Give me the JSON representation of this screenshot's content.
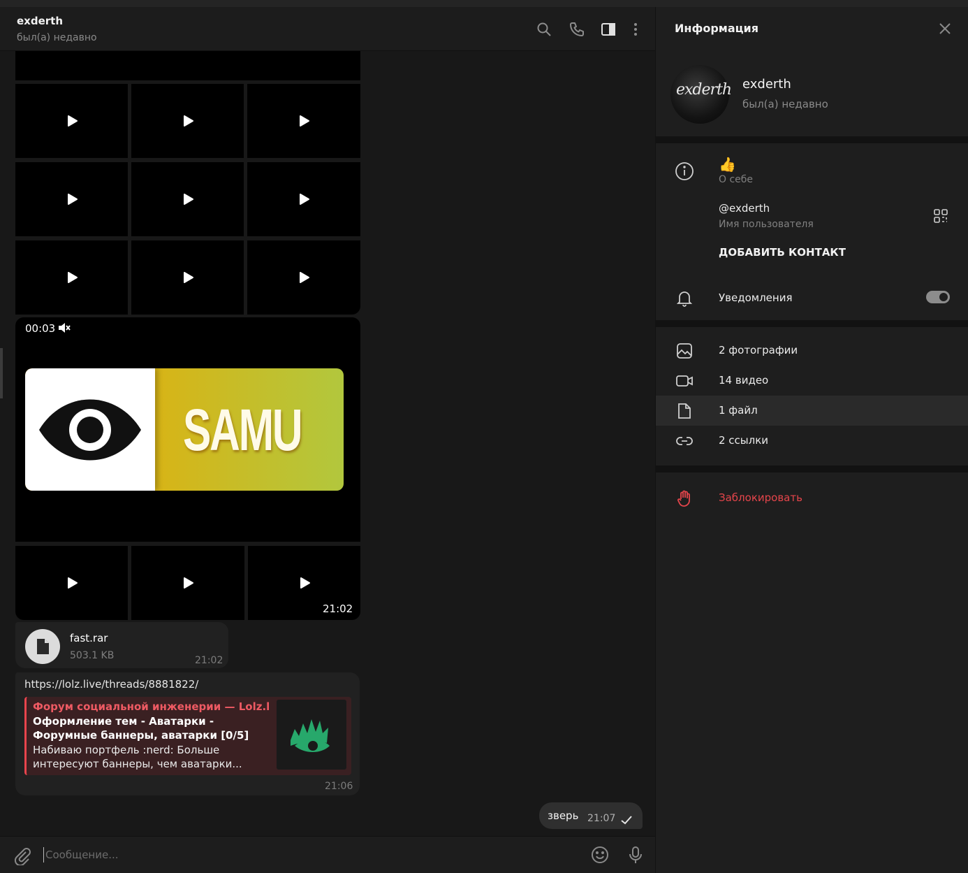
{
  "chat": {
    "title": "exderth",
    "status": "был(а) недавно",
    "video": {
      "duration": "00:03"
    },
    "banner_text": "SAMU",
    "album_time": "21:02",
    "file": {
      "name": "fast.rar",
      "size": "503.1 KB",
      "time": "21:02"
    },
    "link_message": {
      "url": "https://lolz.live/threads/8881822/",
      "preview_site": "Форум социальной инженерии — Lolz.live ...",
      "preview_title": "Оформление тем - Аватарки - Форумные баннеры, аватарки [0/5]",
      "preview_desc": "Набиваю портфель  :nerd: Больше интересуют баннеры, чем аватарки...",
      "time": "21:06"
    },
    "outgoing": {
      "text": "зверь",
      "time": "21:07"
    },
    "composer_placeholder": "Сообщение..."
  },
  "panel": {
    "title": "Информация",
    "name": "exderth",
    "status": "был(а) недавно",
    "avatar_text": "exderth",
    "bio": "👍",
    "bio_label": "О себе",
    "username": "@exderth",
    "username_label": "Имя пользователя",
    "add_contact": "ДОБАВИТЬ КОНТАКТ",
    "notifications": "Уведомления",
    "notifications_enabled": true,
    "media": [
      "2 фотографии",
      "14 видео",
      "1 файл",
      "2 ссылки"
    ],
    "block": "Заблокировать"
  },
  "icons": [
    "search-icon",
    "phone-icon",
    "sidebar-toggle-icon",
    "more-icon",
    "close-icon",
    "info-icon",
    "qr-code-icon",
    "bell-icon",
    "photo-icon",
    "video-icon",
    "file-icon",
    "link-icon",
    "block-hand-icon",
    "attach-icon",
    "emoji-icon",
    "mic-icon",
    "play-icon",
    "mute-icon",
    "check-icon"
  ],
  "colors": {
    "accent_red": "#e5454b",
    "background": "#181818",
    "panel": "#1e1e1e",
    "bubble": "#212121"
  }
}
